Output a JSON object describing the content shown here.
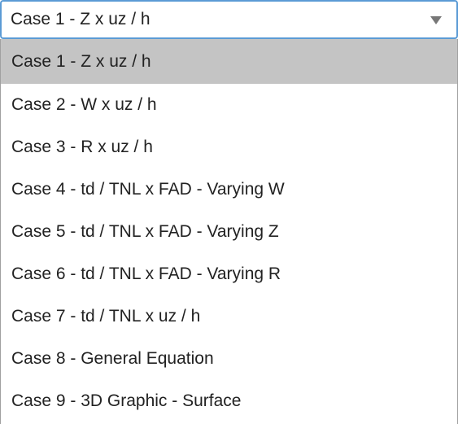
{
  "select": {
    "value": "Case 1 - Z x uz / h",
    "icon": "chevron-down-icon",
    "accent_color": "#5b9bd5",
    "highlight_color": "#c4c4c4",
    "options": [
      "Case 1 - Z x uz / h",
      "Case 2 - W x uz / h",
      "Case 3 - R x uz / h",
      "Case 4 - td / TNL x FAD - Varying W",
      "Case 5 - td / TNL x FAD - Varying Z",
      "Case 6 - td / TNL x FAD - Varying R",
      "Case 7 - td / TNL x uz / h",
      "Case 8 - General Equation",
      "Case 9 - 3D Graphic - Surface"
    ],
    "selected_index": 0
  }
}
